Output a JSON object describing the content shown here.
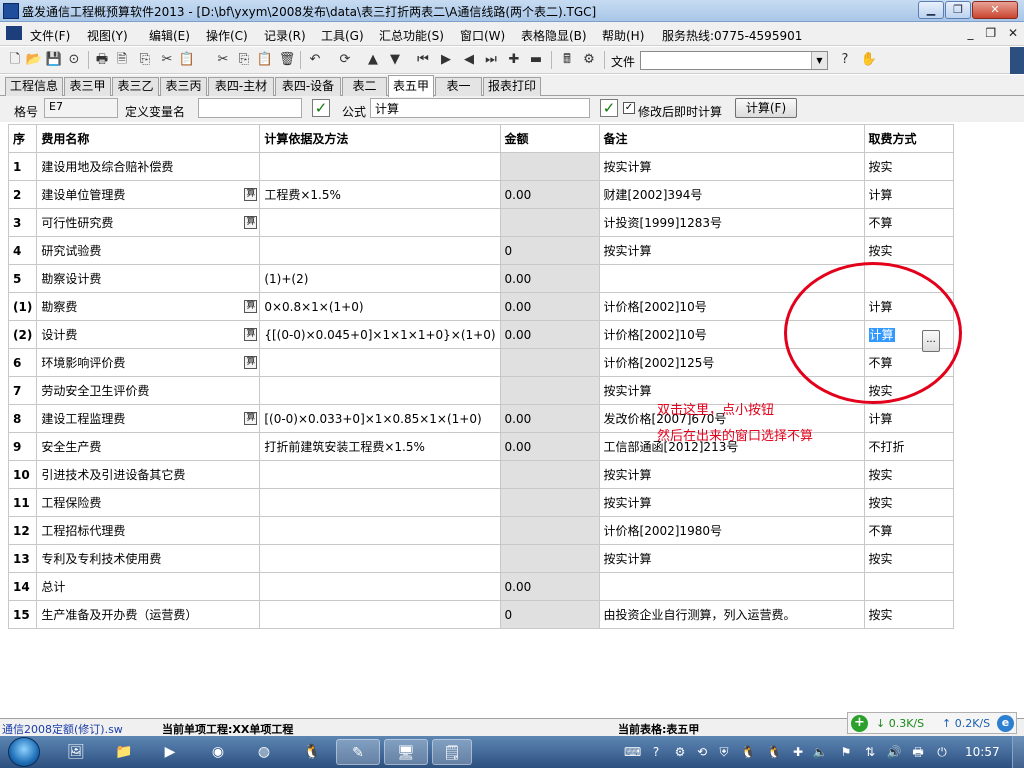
{
  "window": {
    "title": "盛发通信工程概预算软件2013 - [D:\\bf\\yxym\\2008发布\\data\\表三打折两表二\\A通信线路(两个表二).TGC]",
    "min_glyph": "▁",
    "max_glyph": "❐",
    "close_glyph": "✕"
  },
  "menu": {
    "items": [
      "文件(F)",
      "视图(Y)",
      "编辑(E)",
      "操作(C)",
      "记录(R)",
      "工具(G)",
      "汇总功能(S)",
      "窗口(W)",
      "表格隐显(B)",
      "帮助(H)"
    ],
    "hotline": "服务热线:0775-4595901",
    "mdi_min": "_",
    "mdi_restore": "❐",
    "mdi_close": "✕"
  },
  "toolbar": {
    "file_label": "文件",
    "file_value": "",
    "combo_arrow": "▼"
  },
  "tabs": [
    "工程信息",
    "表三甲",
    "表三乙",
    "表三丙",
    "表四-主材",
    "表四-设备",
    "表二",
    "表五甲",
    "表一",
    "报表打印"
  ],
  "active_tab_index": 7,
  "formula_bar": {
    "cell_label": "格号",
    "cell_value": "E7",
    "varname_label": "定义变量名",
    "varname_value": "",
    "formula_label": "公式",
    "formula_value": "计算",
    "checkbox_label": "修改后即时计算",
    "checkbox_checked": true,
    "calc_button": "计算(F)"
  },
  "grid": {
    "headers": [
      "序",
      "费用名称",
      "计算依据及方法",
      "金额",
      "备注",
      "取费方式"
    ],
    "rows": [
      {
        "seq": "1",
        "name": "建设用地及综合赔补偿费",
        "calc_icon": false,
        "basis": "",
        "amount": "",
        "note": "按实计算",
        "mode": "按实"
      },
      {
        "seq": "2",
        "name": "建设单位管理费",
        "calc_icon": true,
        "basis": "工程费×1.5%",
        "amount": "0.00",
        "note": "财建[2002]394号",
        "mode": "计算"
      },
      {
        "seq": "3",
        "name": "可行性研究费",
        "calc_icon": true,
        "basis": "",
        "amount": "",
        "note": "计投资[1999]1283号",
        "mode": "不算"
      },
      {
        "seq": "4",
        "name": "研究试验费",
        "calc_icon": false,
        "basis": "",
        "amount": "0",
        "note": "按实计算",
        "mode": "按实"
      },
      {
        "seq": "5",
        "name": "勘察设计费",
        "calc_icon": false,
        "basis": "(1)+(2)",
        "amount": "0.00",
        "note": "",
        "mode": ""
      },
      {
        "seq": "(1)",
        "name": "勘察费",
        "calc_icon": true,
        "basis": "0×0.8×1×(1+0)",
        "amount": "0.00",
        "note": "计价格[2002]10号",
        "mode": "计算"
      },
      {
        "seq": "(2)",
        "name": "设计费",
        "calc_icon": true,
        "basis": "{[(0-0)×0.045+0]×1×1×1+0}×(1+0)",
        "amount": "0.00",
        "note": "计价格[2002]10号",
        "mode": "计算",
        "selected": true
      },
      {
        "seq": "6",
        "name": "环境影响评价费",
        "calc_icon": true,
        "basis": "",
        "amount": "",
        "note": "计价格[2002]125号",
        "mode": "不算"
      },
      {
        "seq": "7",
        "name": "劳动安全卫生评价费",
        "calc_icon": false,
        "basis": "",
        "amount": "",
        "note": "按实计算",
        "mode": "按实"
      },
      {
        "seq": "8",
        "name": "建设工程监理费",
        "calc_icon": true,
        "basis": "[(0-0)×0.033+0]×1×0.85×1×(1+0)",
        "amount": "0.00",
        "note": "发改价格[2007]670号",
        "mode": "计算"
      },
      {
        "seq": "9",
        "name": "安全生产费",
        "calc_icon": false,
        "basis": "打折前建筑安装工程费×1.5%",
        "amount": "0.00",
        "note": "工信部通函[2012]213号",
        "mode": "不打折"
      },
      {
        "seq": "10",
        "name": "引进技术及引进设备其它费",
        "calc_icon": false,
        "basis": "",
        "amount": "",
        "note": "按实计算",
        "mode": "按实"
      },
      {
        "seq": "11",
        "name": "工程保险费",
        "calc_icon": false,
        "basis": "",
        "amount": "",
        "note": "按实计算",
        "mode": "按实"
      },
      {
        "seq": "12",
        "name": "工程招标代理费",
        "calc_icon": false,
        "basis": "",
        "amount": "",
        "note": "计价格[2002]1980号",
        "mode": "不算"
      },
      {
        "seq": "13",
        "name": "专利及专利技术使用费",
        "calc_icon": false,
        "basis": "",
        "amount": "",
        "note": "按实计算",
        "mode": "按实"
      },
      {
        "seq": "14",
        "name": "总计",
        "calc_icon": false,
        "basis": "",
        "amount": "0.00",
        "note": "",
        "mode": ""
      },
      {
        "seq": "15",
        "name": "生产准备及开办费（运营费）",
        "calc_icon": false,
        "basis": "",
        "amount": "0",
        "note": "由投资企业自行测算，列入运营费。",
        "mode": "按实"
      }
    ],
    "calc_icon_glyph": "算",
    "ellipsis_label": "..."
  },
  "annotation": {
    "line1": "双击这里，点小按钮",
    "line2": "然后在出来的窗口选择不算",
    "color": "#e3001b"
  },
  "status": {
    "left": "通信2008定额(修订).sw",
    "project": "当前单项工程:XX单项工程",
    "table": "当前表格:表五甲"
  },
  "netspeed": {
    "down": "0.3K/S",
    "up": "0.2K/S",
    "plus_glyph": "+",
    "e_glyph": "e"
  },
  "taskbar": {
    "time": "10:57"
  }
}
